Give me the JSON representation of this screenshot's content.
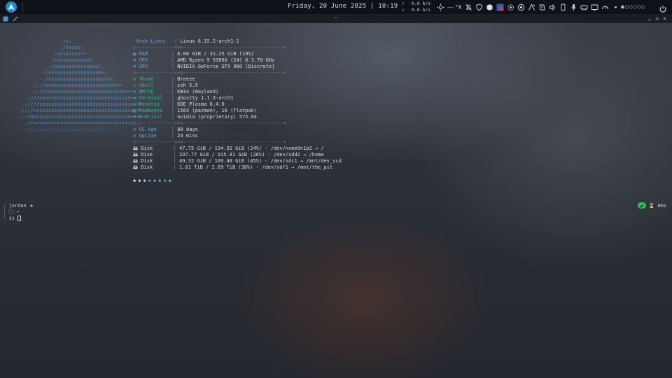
{
  "panel": {
    "clock": "Friday, 20 June 2025 | 10:19",
    "net_up": "0.0 b/s",
    "net_down": "0.0 b/s",
    "temp_text": "--- °X",
    "pager_dots": "●○○○○○",
    "accent": "#1f8ad6"
  },
  "tabbar": {
    "title": "~"
  },
  "fetch": {
    "logo_lines": [
      "                  /o.",
      "                 ./sssso-",
      "               :osssssss+-",
      "              :+sssssssssso/.",
      "             -/ossssssssssssso/.",
      "           -/+sssssssssssssssso+:",
      "          -:/+sssssssssssssssssso+/.",
      "        .::/osssssssssssssssssssssso++-",
      "       .:://+ssssssssssssssssssssssssso++:",
      "     .:///ossssssssssssssssssssssssssssso++:",
      "    .:////ssssssssssssssssssssssssssssssso+++.",
      "  `-////+ssssssssssssssssssssssssssssssssso++++-",
      "   ..-+oossssssssssssssssssssssssssssssso+++++/",
      "     ./++++++++++++++++++++++++++++++++++/:.",
      "    `:::::::::::::::::::::::::::------``"
    ],
    "header_label": "Arch Linux",
    "header_value": "Linux 6.15.2-arch1-1",
    "divider": ">-------------<+>----------------------------------<",
    "hw": [
      {
        "icon": "▤",
        "label": "RAM",
        "value": "6.06 GiB / 31.25 GiB (19%)"
      },
      {
        "icon": "⊕",
        "label": "CPU",
        "value": "AMD Ryzen 9 5900X (24) @ 3.70 GHz"
      },
      {
        "icon": "⊕",
        "label": "GPU",
        "value": "NVIDIA GeForce GTX 960 [Discrete]"
      }
    ],
    "sw": [
      {
        "icon": "⊕",
        "label": "Theme",
        "value": "Breeze"
      },
      {
        "icon": "▭",
        "label": "Shell",
        "value": "zsh 5.9"
      },
      {
        "icon": "⊕",
        "label": "WM/DE",
        "value": "KWin (Wayland)"
      },
      {
        "icon": "▭",
        "label": "Terminal",
        "value": "ghostty 1.1.3-arch1"
      },
      {
        "icon": "▭",
        "label": "Desktop",
        "value": "KDE Plasma 6.4.0"
      },
      {
        "icon": "▤",
        "label": "Packages",
        "value": "1564 (pacman), 16 (flatpak)"
      },
      {
        "icon": "⊕",
        "label": "G-Driver",
        "value": "nvidia (proprietary) 575.64"
      }
    ],
    "age": [
      {
        "icon": "◷",
        "label": "OS Age",
        "value": "80 days"
      },
      {
        "icon": "◷",
        "label": "Uptime",
        "value": "24 mins"
      }
    ],
    "disks": [
      {
        "icon": "🖴",
        "label": "Disk",
        "value": "47.75 GiB / 194.92 GiB (24%) - /dev/nvme0n1p2 → /"
      },
      {
        "icon": "🖴",
        "label": "Disk",
        "value": "237.77 GiB / 915.81 GiB (26%) - /dev/sdd2 → /home"
      },
      {
        "icon": "🖴",
        "label": "Disk",
        "value": "49.32 GiB / 109.48 GiB (45%) - /dev/sdc1 → /mnt/dev_ssd"
      },
      {
        "icon": "🖴",
        "label": "Disk",
        "value": "1.01 TiB / 2.69 TiB (38%) - /dev/sdf1 → /mnt/the_pit"
      }
    ],
    "color_dots": [
      "#e7e9ee",
      "#d4d7dd",
      "#c4c8cf",
      "#4f93cf",
      "#6b9fd4",
      "#7aa6d8",
      "#3bb08f",
      "#5cc2b3"
    ]
  },
  "prompt": {
    "user": "jordan",
    "dir": "~",
    "symbol": "❯❯",
    "duration": "0ms"
  }
}
